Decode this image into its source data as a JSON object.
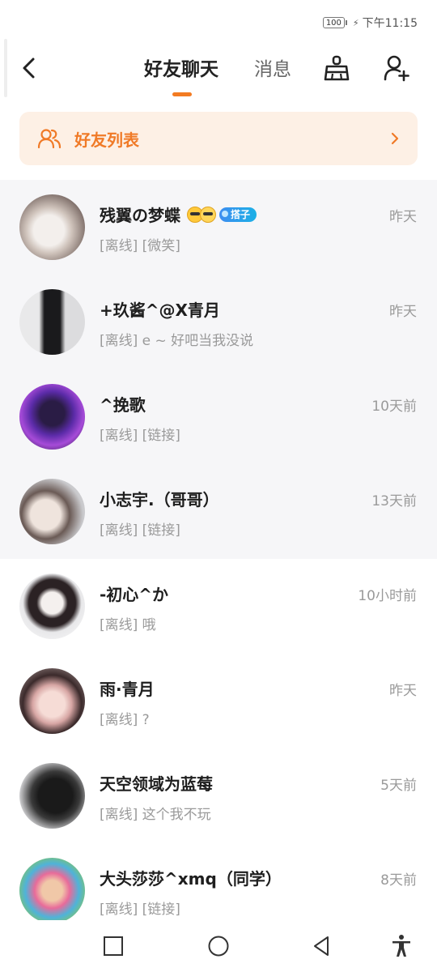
{
  "status_bar": {
    "battery": "100",
    "time": "下午11:15"
  },
  "header": {
    "tabs": [
      {
        "label": "好友聊天",
        "active": true
      },
      {
        "label": "消息",
        "active": false
      }
    ],
    "icons": [
      "back-arrow-icon",
      "broom-icon",
      "add-user-icon"
    ],
    "accent_color": "#f37b22"
  },
  "friend_list_bar": {
    "label": "好友列表",
    "icon": "users-icon",
    "background": "#fdf0e5"
  },
  "chats": [
    {
      "name": "残翼の梦蝶",
      "tag": "搭子",
      "message": "[离线] [微笑]",
      "time": "昨天"
    },
    {
      "name": "+玖酱^@X青月",
      "message": "[离线] e ~ 好吧当我没说",
      "time": "昨天"
    },
    {
      "name": "^挽歌",
      "message": "[离线] [链接]",
      "time": "10天前"
    },
    {
      "name": "小志宇.（哥哥）",
      "message": "[离线] [链接]",
      "time": "13天前"
    },
    {
      "name": "-初心^か",
      "message": "[离线] 哦",
      "time": "10小时前"
    },
    {
      "name": "雨·青月",
      "message": "[离线] ?",
      "time": "昨天"
    },
    {
      "name": "天空领域为蓝莓",
      "message": "[离线] 这个我不玩",
      "time": "5天前"
    },
    {
      "name": "大头莎莎^xmq（同学）",
      "message": "[离线] [链接]",
      "time": "8天前"
    }
  ],
  "nav_bar": {
    "icons": [
      "square-icon",
      "circle-icon",
      "triangle-back-icon",
      "accessibility-icon"
    ]
  }
}
